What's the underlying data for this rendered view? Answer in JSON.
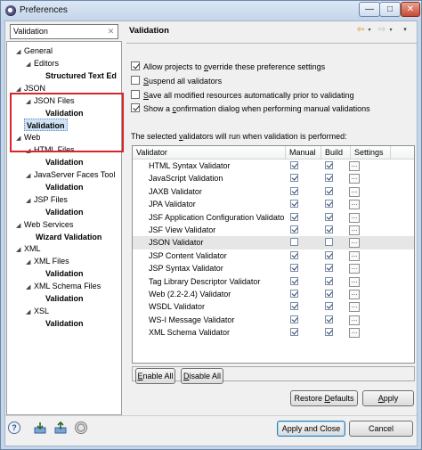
{
  "window": {
    "title": "Preferences",
    "controls": {
      "minimize": "—",
      "maximize": "□",
      "close": "✕"
    }
  },
  "filter": {
    "value": "Validation",
    "clear_icon": "✕"
  },
  "tree": {
    "nodes": [
      {
        "label": "General",
        "twisty": "◢",
        "bold": false
      },
      {
        "label": "Editors",
        "twisty": "◢",
        "bold": false
      },
      {
        "label": "Structured Text Ed",
        "twisty": "",
        "bold": true
      },
      {
        "label": "JSON",
        "twisty": "◢",
        "bold": false
      },
      {
        "label": "JSON Files",
        "twisty": "◢",
        "bold": false
      },
      {
        "label": "Validation",
        "twisty": "",
        "bold": true
      },
      {
        "label": "Validation",
        "twisty": "",
        "bold": true,
        "selected": true
      },
      {
        "label": "Web",
        "twisty": "◢",
        "bold": false
      },
      {
        "label": "HTML Files",
        "twisty": "◢",
        "bold": false
      },
      {
        "label": "Validation",
        "twisty": "",
        "bold": true
      },
      {
        "label": "JavaServer Faces Tool",
        "twisty": "◢",
        "bold": false
      },
      {
        "label": "Validation",
        "twisty": "",
        "bold": true
      },
      {
        "label": "JSP Files",
        "twisty": "◢",
        "bold": false
      },
      {
        "label": "Validation",
        "twisty": "",
        "bold": true
      },
      {
        "label": "Web Services",
        "twisty": "◢",
        "bold": false
      },
      {
        "label": "Wizard Validation",
        "twisty": "",
        "bold": true
      },
      {
        "label": "XML",
        "twisty": "◢",
        "bold": false
      },
      {
        "label": "XML Files",
        "twisty": "◢",
        "bold": false
      },
      {
        "label": "Validation",
        "twisty": "",
        "bold": true
      },
      {
        "label": "XML Schema Files",
        "twisty": "◢",
        "bold": false
      },
      {
        "label": "Validation",
        "twisty": "",
        "bold": true
      },
      {
        "label": "XSL",
        "twisty": "◢",
        "bold": false
      },
      {
        "label": "Validation",
        "twisty": "",
        "bold": true
      }
    ]
  },
  "page": {
    "title": "Validation",
    "nav": {
      "back_icon": "⇦",
      "dropdown_icon": "▾",
      "forward_icon": "⇨",
      "menu_icon": "▾"
    }
  },
  "options": {
    "allow_override": {
      "pre": "Allow projects to ",
      "mn": "o",
      "post": "verride these preference settings",
      "checked": true
    },
    "suspend_all": {
      "pre": "",
      "mn": "S",
      "post": "uspend all validators",
      "checked": false
    },
    "save_all": {
      "pre": "",
      "mn": "S",
      "post": "ave all modified resources automatically prior to validating",
      "checked": false
    },
    "show_confirm": {
      "pre": "Show a ",
      "mn": "c",
      "post": "onfirmation dialog when performing manual validations",
      "checked": true
    }
  },
  "table": {
    "caption_pre": "The selected ",
    "caption_mn": "v",
    "caption_post": "alidators will run when validation is performed:",
    "columns": {
      "validator": "Validator",
      "manual": "Manual",
      "build": "Build",
      "settings": "Settings"
    },
    "settings_glyph": "...",
    "rows": [
      {
        "name": "HTML Syntax Validator",
        "manual": true,
        "build": true
      },
      {
        "name": "JavaScript Validation",
        "manual": true,
        "build": true
      },
      {
        "name": "JAXB Validator",
        "manual": true,
        "build": true
      },
      {
        "name": "JPA Validator",
        "manual": true,
        "build": true
      },
      {
        "name": "JSF Application Configuration Validator",
        "manual": true,
        "build": true
      },
      {
        "name": "JSF View Validator",
        "manual": true,
        "build": true
      },
      {
        "name": "JSON Validator",
        "manual": false,
        "build": false,
        "highlighted": true
      },
      {
        "name": "JSP Content Validator",
        "manual": true,
        "build": true
      },
      {
        "name": "JSP Syntax Validator",
        "manual": true,
        "build": true
      },
      {
        "name": "Tag Library Descriptor Validator",
        "manual": true,
        "build": true
      },
      {
        "name": "Web (2.2-2.4) Validator",
        "manual": true,
        "build": true
      },
      {
        "name": "WSDL Validator",
        "manual": true,
        "build": true
      },
      {
        "name": "WS-I Message Validator",
        "manual": true,
        "build": true
      },
      {
        "name": "XML Schema Validator",
        "manual": true,
        "build": true
      }
    ]
  },
  "buttons": {
    "enable_all": {
      "mn": "E",
      "rest": "nable All"
    },
    "disable_all": {
      "mn": "D",
      "rest": "isable All"
    },
    "restore_defaults": {
      "pre": "Restore ",
      "mn": "D",
      "rest": "efaults"
    },
    "apply": {
      "mn": "A",
      "rest": "pply"
    },
    "apply_and_close": "Apply and Close",
    "cancel": "Cancel"
  },
  "bottom_icons": {
    "help": "?"
  }
}
